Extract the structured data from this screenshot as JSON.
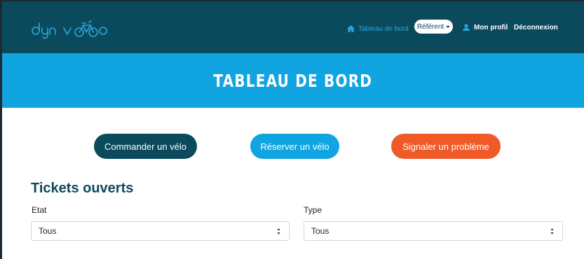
{
  "header": {
    "logo_text": "dynàvo",
    "nav_home": "Tableau de bord",
    "nav_referent": "Référent",
    "nav_profile": "Mon profil",
    "nav_logout": "Déconnexion",
    "colors": {
      "navbar": "#0b4a5c",
      "accent": "#29a6dc"
    }
  },
  "banner": {
    "title": "TABLEAU DE BORD",
    "color": "#10a4e1"
  },
  "actions": {
    "commander": "Commander un vélo",
    "reserver": "Réserver un vélo",
    "signaler": "Signaler un problème",
    "colors": {
      "commander": "#0b4a5c",
      "reserver": "#10a4e1",
      "signaler": "#f05a28"
    }
  },
  "tickets": {
    "title": "Tickets ouverts",
    "filters": {
      "etat": {
        "label": "Etat",
        "value": "Tous"
      },
      "type": {
        "label": "Type",
        "value": "Tous"
      }
    }
  },
  "icons": [
    "home-icon",
    "user-icon",
    "caret-down-icon",
    "select-arrows-icon",
    "bike-logo-icon"
  ]
}
